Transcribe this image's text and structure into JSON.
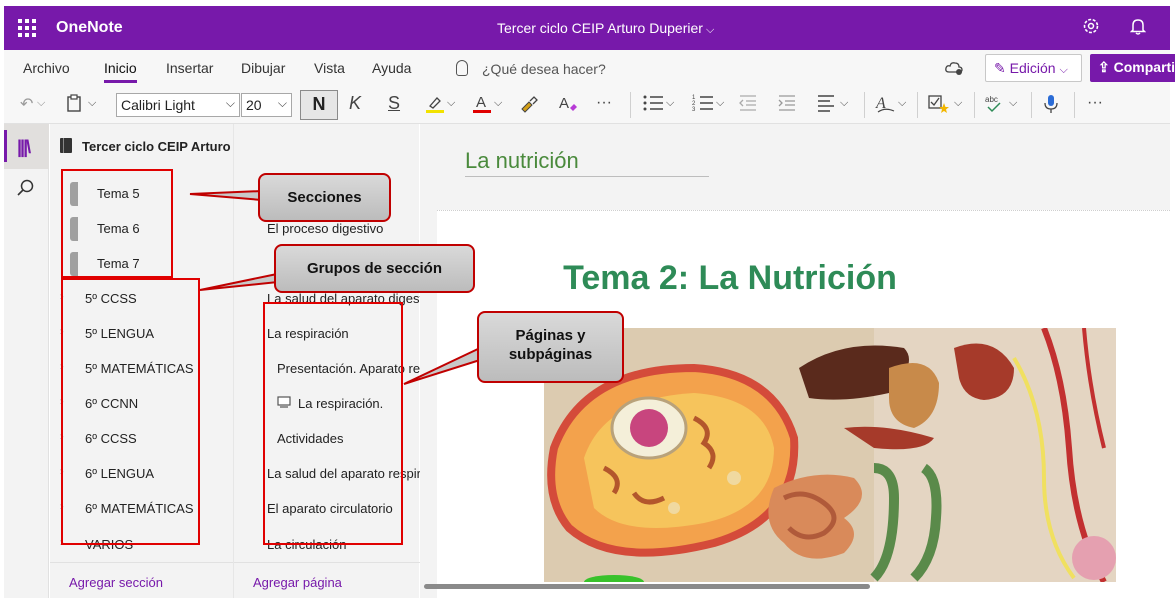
{
  "titlebar": {
    "app_name": "OneNote",
    "doc_title": "Tercer ciclo CEIP Arturo Duperier",
    "doc_chevron": "⌵",
    "settings_icon": "⚙",
    "bell_icon": "🔔"
  },
  "ribbon": {
    "tabs": [
      "Archivo",
      "Inicio",
      "Insertar",
      "Dibujar",
      "Vista",
      "Ayuda"
    ],
    "search_placeholder": "¿Qué desea hacer?",
    "edit_label": "Edición",
    "share_label": "Compartir",
    "active_tab": "Inicio",
    "accent_color": "#7719aa"
  },
  "toolbar": {
    "font_name": "Calibri Light",
    "font_size": "20",
    "bold_label": "N",
    "italic_label": "K",
    "underline_label": "S",
    "more_label": "···",
    "highlight_color": "#f2e200",
    "font_color": "#e00000"
  },
  "notebook": {
    "title": "Tercer ciclo CEIP Arturo Duperier",
    "sections": [
      "Tema 5",
      "Tema 6",
      "Tema 7"
    ],
    "section_groups": [
      "5º CCSS",
      "5º LENGUA",
      "5º MATEMÁTICAS",
      "6º CCNN",
      "6º CCSS",
      "6º LENGUA",
      "6º MATEMÁTICAS",
      "VARIOS"
    ],
    "add_section": "Agregar sección"
  },
  "pages": {
    "items": [
      {
        "label": "El proceso digestivo",
        "indent": 0
      },
      {
        "label": "La salud del aparato digestivo",
        "indent": 0
      },
      {
        "label": "La respiración",
        "indent": 0
      },
      {
        "label": "Presentación. Aparato respiratorio",
        "indent": 1
      },
      {
        "label": "La respiración.",
        "indent": 1
      },
      {
        "label": "Actividades",
        "indent": 1
      },
      {
        "label": "La salud del aparato respiratorio",
        "indent": 0
      },
      {
        "label": "El aparato circulatorio",
        "indent": 0
      },
      {
        "label": "La circulación",
        "indent": 0
      }
    ],
    "add_page": "Agregar página"
  },
  "content": {
    "page_title": "La nutrición",
    "heading": "Tema 2: La Nutrición"
  },
  "annotations": {
    "sections_label": "Secciones",
    "groups_label": "Grupos de sección",
    "pages_label": "Páginas y subpáginas",
    "box_color": "#e00000"
  }
}
